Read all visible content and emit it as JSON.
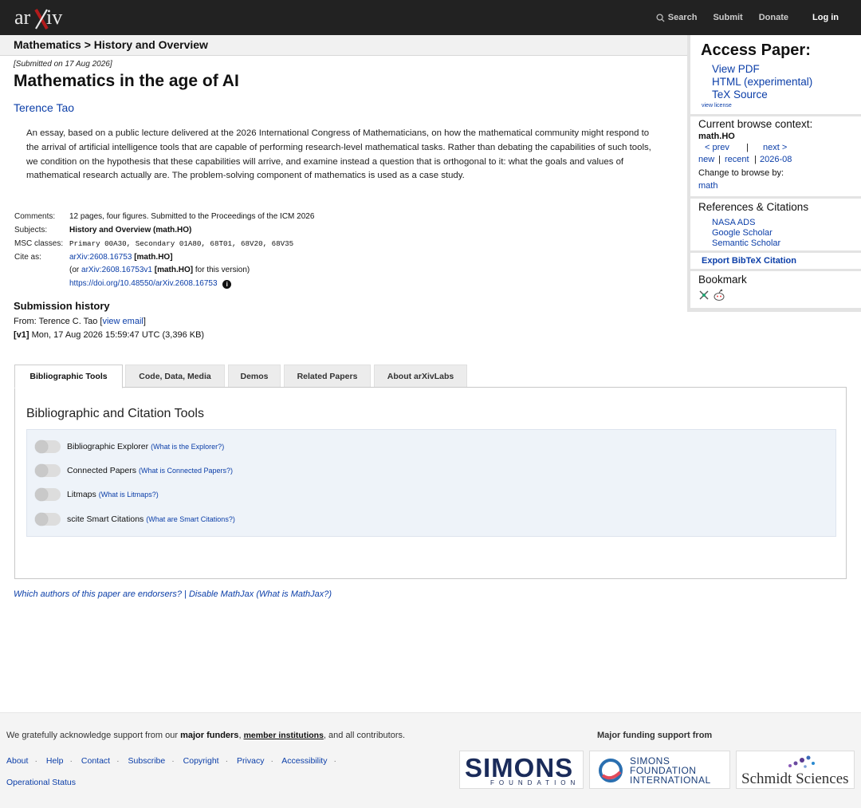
{
  "topbar": {
    "logo_text": "arXiv",
    "search_label": "Search",
    "submit_label": "Submit",
    "donate_label": "Donate",
    "login_label": "Log in"
  },
  "breadcrumb": "Mathematics > History and Overview",
  "paper": {
    "submitted": "[Submitted on 17 Aug 2026]",
    "title": "Mathematics in the age of AI",
    "author": "Terence Tao",
    "abstract": "An essay, based on a public lecture delivered at the 2026 International Congress of Mathematicians, on how the mathematical community might respond to the arrival of artificial intelligence tools that are capable of performing research-level mathematical tasks. Rather than debating the capabilities of such tools, we condition on the hypothesis that these capabilities will arrive, and examine instead a question that is orthogonal to it: what the goals and values of mathematical research actually are. The problem-solving component of mathematics is used as a case study."
  },
  "meta": {
    "comments_label": "Comments:",
    "comments": "12 pages, four figures. Submitted to the Proceedings of the ICM 2026",
    "subjects_label": "Subjects:",
    "subjects": "History and Overview (math.HO)",
    "msc_label": "MSC classes:",
    "msc": "Primary 00A30, Secondary 01A80, 68T01, 68V20, 68V35",
    "cite_label": "Cite as:",
    "cite_id": "arXiv:2608.16753",
    "cite_cat": "[math.HO]",
    "cite_or": "(or",
    "cite_v1": "arXiv:2608.16753v1",
    "cite_v1_cat": "[math.HO]",
    "cite_version": "for this version)",
    "doi": "https://doi.org/10.48550/arXiv.2608.16753"
  },
  "history": {
    "heading": "Submission history",
    "from": "From: Terence C. Tao [",
    "view_email": "view email",
    "from_close": "]",
    "v1": "[v1]",
    "v1_date": "Mon, 17 Aug 2026 15:59:47 UTC (3,396 KB)"
  },
  "sidebar": {
    "access_heading": "Access Paper:",
    "view_pdf": "View PDF",
    "html": "HTML (experimental)",
    "tex": "TeX Source",
    "view_license": "view license",
    "context_heading": "Current browse context:",
    "context": "math.HO",
    "prev": "< prev",
    "bar": "|",
    "next": "next >",
    "new": "new",
    "recent": "recent",
    "month": "2026-08",
    "change_browse": "Change to browse by:",
    "math": "math",
    "refs_heading": "References & Citations",
    "nasa": "NASA ADS",
    "google": "Google Scholar",
    "semantic": "Semantic Scholar",
    "bibtex": "Export BibTeX Citation",
    "bookmark_heading": "Bookmark"
  },
  "tabs": [
    "Bibliographic Tools",
    "Code, Data, Media",
    "Demos",
    "Related Papers",
    "About arXivLabs"
  ],
  "tools": {
    "heading": "Bibliographic and Citation Tools",
    "items": [
      {
        "label": "Bibliographic Explorer",
        "help": "What is the Explorer?"
      },
      {
        "label": "Connected Papers",
        "help": "What is Connected Papers?"
      },
      {
        "label": "Litmaps",
        "help": "What is Litmaps?"
      },
      {
        "label": "scite Smart Citations",
        "help": "What are Smart Citations?"
      }
    ]
  },
  "endorse": {
    "endorsers": "Which authors of this paper are endorsers?",
    "sep": "|",
    "disable": "Disable MathJax",
    "what": "(What is MathJax?)"
  },
  "footer": {
    "ack_pre": "We gratefully acknowledge support from our",
    "major_funders": "major funders",
    "comma": ",",
    "member": "member institutions",
    "ack_post": ", and all contributors.",
    "major_support": "Major funding support from",
    "links": [
      "About",
      "Help",
      "Contact",
      "Subscribe",
      "Copyright",
      "Privacy",
      "Accessibility"
    ],
    "status": "Operational Status",
    "simons": "SIMONS",
    "simons_sub": "FOUNDATION",
    "sfi_1": "SIMONS",
    "sfi_2": "FOUNDATION",
    "sfi_3": "INTERNATIONAL",
    "schmidt": "Schmidt Sciences"
  },
  "colors": {
    "link": "#0b3ea8",
    "topbar": "#222222",
    "panel_bg": "#eef3f9"
  }
}
